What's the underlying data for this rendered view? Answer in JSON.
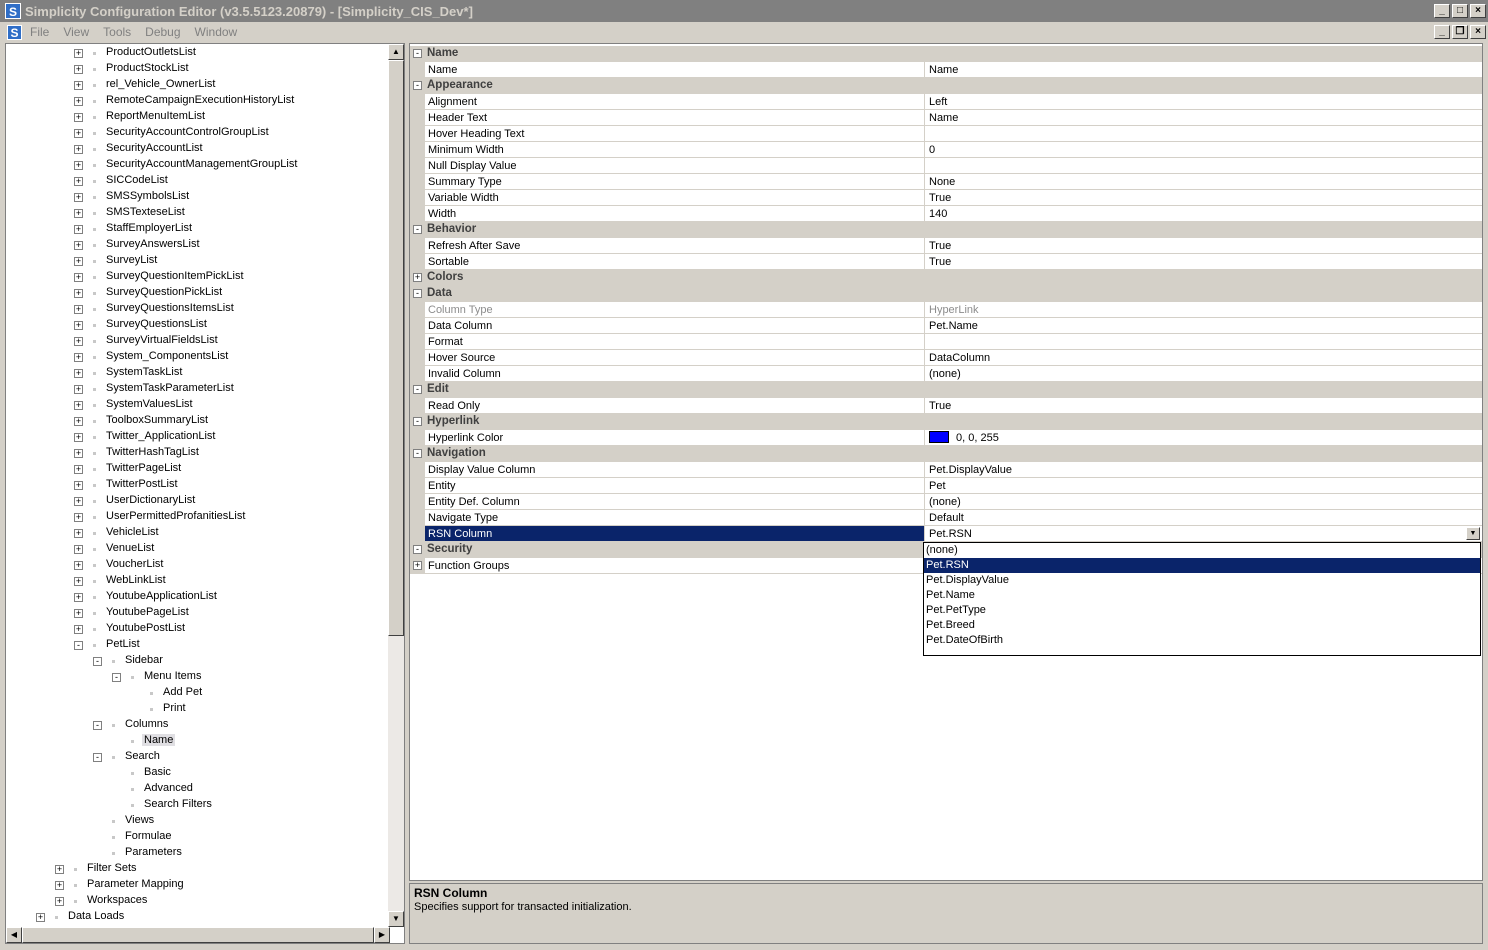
{
  "window": {
    "title": "Simplicity Configuration Editor (v3.5.5123.20879) - [Simplicity_CIS_Dev*]",
    "icon": "S",
    "buttons": [
      "_",
      "□",
      "×"
    ]
  },
  "menubar": {
    "icon": "S",
    "items": [
      "File",
      "View",
      "Tools",
      "Debug",
      "Window"
    ],
    "mdi_buttons": [
      "_",
      "❐",
      "×"
    ]
  },
  "tree": {
    "rows": [
      {
        "label": "ProductOutletsList",
        "level": 2,
        "exp": "+"
      },
      {
        "label": "ProductStockList",
        "level": 2,
        "exp": "+"
      },
      {
        "label": "rel_Vehicle_OwnerList",
        "level": 2,
        "exp": "+"
      },
      {
        "label": "RemoteCampaignExecutionHistoryList",
        "level": 2,
        "exp": "+"
      },
      {
        "label": "ReportMenuItemList",
        "level": 2,
        "exp": "+"
      },
      {
        "label": "SecurityAccountControlGroupList",
        "level": 2,
        "exp": "+"
      },
      {
        "label": "SecurityAccountList",
        "level": 2,
        "exp": "+"
      },
      {
        "label": "SecurityAccountManagementGroupList",
        "level": 2,
        "exp": "+"
      },
      {
        "label": "SICCodeList",
        "level": 2,
        "exp": "+"
      },
      {
        "label": "SMSSymbolsList",
        "level": 2,
        "exp": "+"
      },
      {
        "label": "SMSTexteseList",
        "level": 2,
        "exp": "+"
      },
      {
        "label": "StaffEmployerList",
        "level": 2,
        "exp": "+"
      },
      {
        "label": "SurveyAnswersList",
        "level": 2,
        "exp": "+"
      },
      {
        "label": "SurveyList",
        "level": 2,
        "exp": "+"
      },
      {
        "label": "SurveyQuestionItemPickList",
        "level": 2,
        "exp": "+"
      },
      {
        "label": "SurveyQuestionPickList",
        "level": 2,
        "exp": "+"
      },
      {
        "label": "SurveyQuestionsItemsList",
        "level": 2,
        "exp": "+"
      },
      {
        "label": "SurveyQuestionsList",
        "level": 2,
        "exp": "+"
      },
      {
        "label": "SurveyVirtualFieldsList",
        "level": 2,
        "exp": "+"
      },
      {
        "label": "System_ComponentsList",
        "level": 2,
        "exp": "+"
      },
      {
        "label": "SystemTaskList",
        "level": 2,
        "exp": "+"
      },
      {
        "label": "SystemTaskParameterList",
        "level": 2,
        "exp": "+"
      },
      {
        "label": "SystemValuesList",
        "level": 2,
        "exp": "+"
      },
      {
        "label": "ToolboxSummaryList",
        "level": 2,
        "exp": "+"
      },
      {
        "label": "Twitter_ApplicationList",
        "level": 2,
        "exp": "+"
      },
      {
        "label": "TwitterHashTagList",
        "level": 2,
        "exp": "+"
      },
      {
        "label": "TwitterPageList",
        "level": 2,
        "exp": "+"
      },
      {
        "label": "TwitterPostList",
        "level": 2,
        "exp": "+"
      },
      {
        "label": "UserDictionaryList",
        "level": 2,
        "exp": "+"
      },
      {
        "label": "UserPermittedProfanitiesList",
        "level": 2,
        "exp": "+"
      },
      {
        "label": "VehicleList",
        "level": 2,
        "exp": "+"
      },
      {
        "label": "VenueList",
        "level": 2,
        "exp": "+"
      },
      {
        "label": "VoucherList",
        "level": 2,
        "exp": "+"
      },
      {
        "label": "WebLinkList",
        "level": 2,
        "exp": "+"
      },
      {
        "label": "YoutubeApplicationList",
        "level": 2,
        "exp": "+"
      },
      {
        "label": "YoutubePageList",
        "level": 2,
        "exp": "+"
      },
      {
        "label": "YoutubePostList",
        "level": 2,
        "exp": "+"
      },
      {
        "label": "PetList",
        "level": 2,
        "exp": "-"
      },
      {
        "label": "Sidebar",
        "level": 3,
        "exp": "-"
      },
      {
        "label": "Menu Items",
        "level": 4,
        "exp": "-"
      },
      {
        "label": "Add Pet",
        "level": 5,
        "exp": ""
      },
      {
        "label": "Print",
        "level": 5,
        "exp": ""
      },
      {
        "label": "Columns",
        "level": 3,
        "exp": "-"
      },
      {
        "label": "Name",
        "level": 4,
        "exp": "",
        "selected": true
      },
      {
        "label": "Search",
        "level": 3,
        "exp": "-"
      },
      {
        "label": "Basic",
        "level": 4,
        "exp": ""
      },
      {
        "label": "Advanced",
        "level": 4,
        "exp": ""
      },
      {
        "label": "Search Filters",
        "level": 4,
        "exp": ""
      },
      {
        "label": "Views",
        "level": 3,
        "exp": ""
      },
      {
        "label": "Formulae",
        "level": 3,
        "exp": ""
      },
      {
        "label": "Parameters",
        "level": 3,
        "exp": ""
      },
      {
        "label": "Filter Sets",
        "level": 1,
        "exp": "+"
      },
      {
        "label": "Parameter Mapping",
        "level": 1,
        "exp": "+"
      },
      {
        "label": "Workspaces",
        "level": 1,
        "exp": "+"
      },
      {
        "label": "Data Loads",
        "level": 0,
        "exp": "+"
      }
    ]
  },
  "properties": {
    "rows": [
      {
        "type": "cat",
        "name": "Name",
        "exp": "-"
      },
      {
        "type": "prop",
        "name": "Name",
        "value": "Name"
      },
      {
        "type": "cat",
        "name": "Appearance",
        "exp": "-"
      },
      {
        "type": "prop",
        "name": "Alignment",
        "value": "Left"
      },
      {
        "type": "prop",
        "name": "Header Text",
        "value": "Name"
      },
      {
        "type": "prop",
        "name": "Hover Heading Text",
        "value": ""
      },
      {
        "type": "prop",
        "name": "Minimum Width",
        "value": "0"
      },
      {
        "type": "prop",
        "name": "Null Display Value",
        "value": ""
      },
      {
        "type": "prop",
        "name": "Summary Type",
        "value": "None"
      },
      {
        "type": "prop",
        "name": "Variable Width",
        "value": "True"
      },
      {
        "type": "prop",
        "name": "Width",
        "value": "140"
      },
      {
        "type": "cat",
        "name": "Behavior",
        "exp": "-"
      },
      {
        "type": "prop",
        "name": "Refresh After Save",
        "value": "True"
      },
      {
        "type": "prop",
        "name": "Sortable",
        "value": "True"
      },
      {
        "type": "cat",
        "name": "Colors",
        "exp": "+"
      },
      {
        "type": "cat",
        "name": "Data",
        "exp": "-"
      },
      {
        "type": "prop",
        "name": "Column Type",
        "value": "HyperLink",
        "disabled": true
      },
      {
        "type": "prop",
        "name": "Data Column",
        "value": "Pet.Name"
      },
      {
        "type": "prop",
        "name": "Format",
        "value": ""
      },
      {
        "type": "prop",
        "name": "Hover Source",
        "value": "DataColumn"
      },
      {
        "type": "prop",
        "name": "Invalid Column",
        "value": "(none)"
      },
      {
        "type": "cat",
        "name": "Edit",
        "exp": "-"
      },
      {
        "type": "prop",
        "name": "Read Only",
        "value": "True"
      },
      {
        "type": "cat",
        "name": "Hyperlink",
        "exp": "-"
      },
      {
        "type": "prop",
        "name": "Hyperlink Color",
        "value": "0, 0, 255",
        "swatch": "#0000ff"
      },
      {
        "type": "cat",
        "name": "Navigation",
        "exp": "-"
      },
      {
        "type": "prop",
        "name": "Display Value Column",
        "value": "Pet.DisplayValue"
      },
      {
        "type": "prop",
        "name": "Entity",
        "value": "Pet"
      },
      {
        "type": "prop",
        "name": "Entity Def. Column",
        "value": "(none)"
      },
      {
        "type": "prop",
        "name": "Navigate Type",
        "value": "Default"
      },
      {
        "type": "prop",
        "name": "RSN Column",
        "value": "Pet.RSN",
        "selected": true,
        "dropdown": true
      },
      {
        "type": "cat",
        "name": "Security",
        "exp": "-"
      },
      {
        "type": "prop",
        "name": "Function Groups",
        "value": "",
        "sub_exp": "+"
      }
    ]
  },
  "dropdown": {
    "options": [
      "(none)",
      "Pet.RSN",
      "Pet.DisplayValue",
      "Pet.Name",
      "Pet.PetType",
      "Pet.Breed",
      "Pet.DateOfBirth"
    ],
    "selected": "Pet.RSN"
  },
  "help": {
    "title": "RSN Column",
    "description": "Specifies support for transacted initialization."
  },
  "colors": {
    "selection": "#0a246a",
    "hyperlink_swatch": "#0000ff",
    "chrome": "#d4d0c8"
  }
}
